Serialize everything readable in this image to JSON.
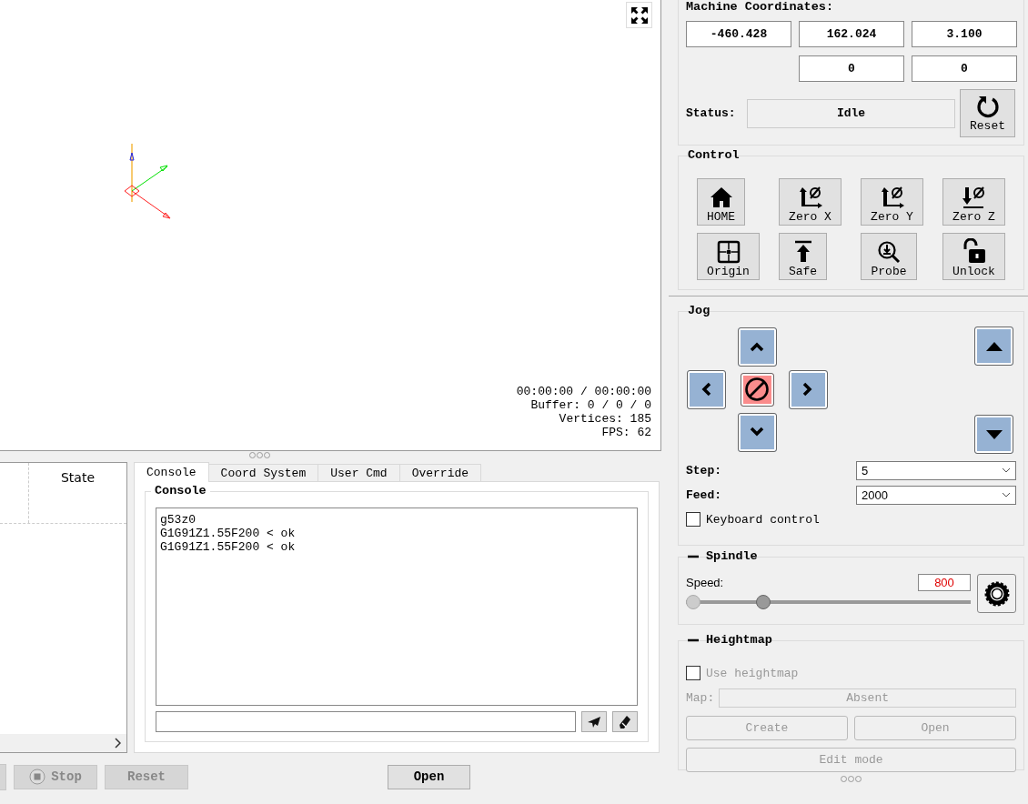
{
  "viewer": {
    "time": "00:00:00 / 00:00:00",
    "buffer": "Buffer: 0 / 0 / 0",
    "vertices": "Vertices: 185",
    "fps": "FPS: 62"
  },
  "table": {
    "columns": [
      {
        "label": "State"
      }
    ]
  },
  "tabs": [
    {
      "label": "Console",
      "selected": true
    },
    {
      "label": "Coord System",
      "selected": false
    },
    {
      "label": "User Cmd",
      "selected": false
    },
    {
      "label": "Override",
      "selected": false
    }
  ],
  "console": {
    "title": "Console",
    "lines": [
      "g53z0",
      "G1G91Z1.55F200 < ok",
      "G1G91Z1.55F200 < ok"
    ]
  },
  "bottom_buttons": [
    {
      "kind": "stop",
      "label": "Stop",
      "disabled": true
    },
    {
      "kind": "plain",
      "label": "Reset",
      "disabled": true
    },
    {
      "kind": "open",
      "label": "Open",
      "disabled": false
    }
  ],
  "coordinates": {
    "title": "Machine Coordinates:",
    "row_1": [
      "-460.428",
      "162.024",
      "3.100"
    ],
    "row_2": [
      "0",
      "0"
    ],
    "status_label": "Status:",
    "status": "Idle",
    "reset_button": "Reset"
  },
  "control": {
    "title": "Control",
    "buttons": [
      {
        "kind": "home",
        "label": "HOME"
      },
      {
        "kind": "zero_x",
        "label": "Zero X"
      },
      {
        "kind": "zero_y",
        "label": "Zero Y"
      },
      {
        "kind": "zero_z",
        "label": "Zero Z"
      },
      {
        "kind": "origin",
        "label": "Origin"
      },
      {
        "kind": "safe",
        "label": "Safe"
      },
      {
        "kind": "probe",
        "label": "Probe"
      },
      {
        "kind": "unlock",
        "label": "Unlock"
      }
    ]
  },
  "jog": {
    "title": "Jog",
    "step_label": "Step:",
    "step": "5",
    "feed_label": "Feed:",
    "feed": "2000",
    "keyboard_label": "Keyboard control",
    "keyboard_checked": false
  },
  "spindle": {
    "title": "Spindle",
    "expanded": true,
    "speed_label": "Speed:",
    "speed": "800",
    "level": 0.26
  },
  "heightmap": {
    "title": "Heightmap",
    "expanded": true,
    "use_label": "Use heightmap",
    "use_checked": false,
    "disabled": true,
    "map_label": "Map:",
    "map": "Absent",
    "create": "Create",
    "open": "Open",
    "edit": "Edit mode"
  }
}
